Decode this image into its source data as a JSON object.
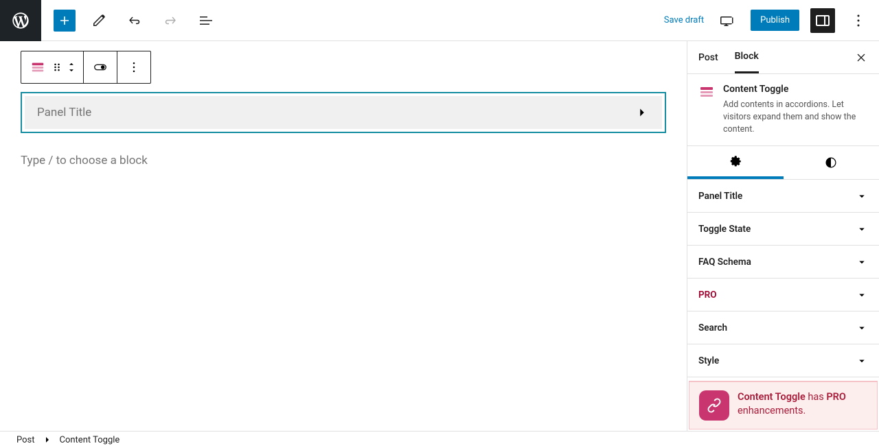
{
  "topbar": {
    "save_draft": "Save draft",
    "publish": "Publish"
  },
  "editor": {
    "panel_placeholder": "Panel Title",
    "type_prompt": "Type / to choose a block"
  },
  "sidebar": {
    "tabs": {
      "post": "Post",
      "block": "Block"
    },
    "block_name": "Content Toggle",
    "block_desc": "Add contents in accordions. Let visitors expand them and show the content.",
    "panels": [
      {
        "label": "Panel Title",
        "key": "panel-title"
      },
      {
        "label": "Toggle State",
        "key": "toggle-state"
      },
      {
        "label": "FAQ Schema",
        "key": "faq-schema"
      },
      {
        "label": "PRO",
        "key": "pro",
        "pro": true
      },
      {
        "label": "Search",
        "key": "search"
      },
      {
        "label": "Style",
        "key": "style"
      }
    ],
    "pro_banner": {
      "name": "Content Toggle",
      "has": " has ",
      "pro": "PRO",
      "enh": "enhancements."
    }
  },
  "breadcrumb": {
    "root": "Post",
    "current": "Content Toggle"
  }
}
